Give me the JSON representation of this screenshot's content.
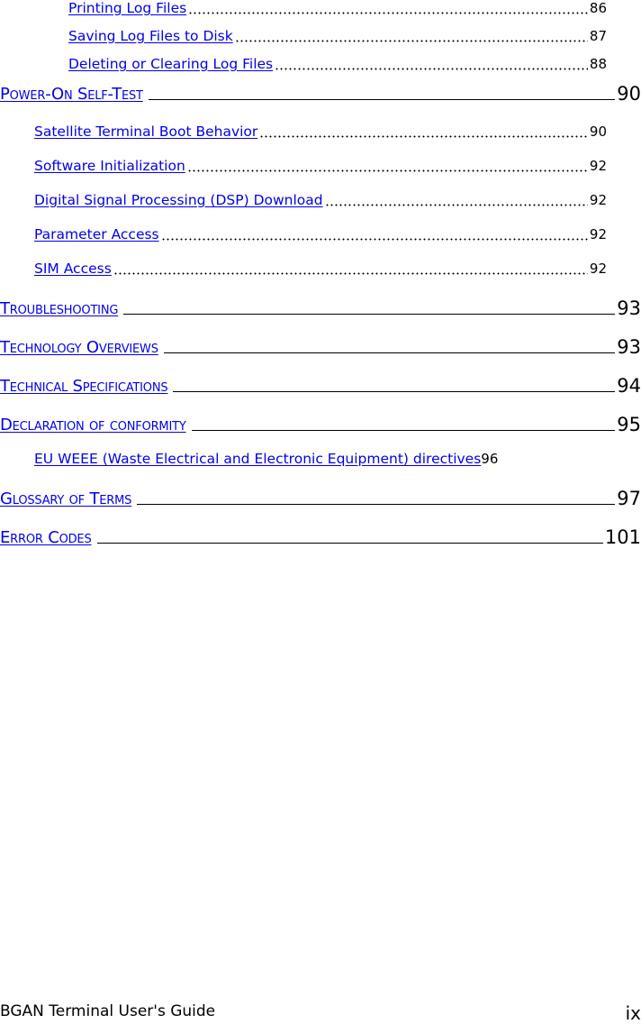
{
  "toc": [
    {
      "level": 3,
      "title": "Printing Log Files",
      "page": "86"
    },
    {
      "level": 3,
      "title": "Saving Log Files to Disk",
      "page": "87"
    },
    {
      "level": 3,
      "title": "Deleting or Clearing Log Files",
      "page": "88"
    },
    {
      "level": 1,
      "title": "Power-On Self-Test",
      "page": "90"
    },
    {
      "level": 2,
      "title": "Satellite Terminal Boot Behavior",
      "page": "90"
    },
    {
      "level": 2,
      "title": "Software Initialization",
      "page": "92"
    },
    {
      "level": 2,
      "title": "Digital Signal Processing (DSP) Download",
      "page": "92"
    },
    {
      "level": 2,
      "title": "Parameter Access",
      "page": "92"
    },
    {
      "level": 2,
      "title": "SIM Access",
      "page": "92"
    },
    {
      "level": 1,
      "title": "Troubleshooting",
      "page": "93"
    },
    {
      "level": 1,
      "title": "Technology Overviews",
      "page": "93"
    },
    {
      "level": 1,
      "title": "Technical Specifications",
      "page": "94"
    },
    {
      "level": 1,
      "title": "Declaration of conformity",
      "page": "95"
    },
    {
      "level": 2,
      "title": "EU WEEE (Waste Electrical and Electronic Equipment) directives",
      "page": "96"
    },
    {
      "level": 1,
      "title": "Glossary of Terms",
      "page": "97"
    },
    {
      "level": 1,
      "title": "Error Codes",
      "page": "101"
    }
  ],
  "footer": {
    "document_title": "BGAN Terminal User's Guide",
    "page_number": "ix"
  },
  "colors": {
    "link": "#0000ee",
    "text": "#000000"
  }
}
